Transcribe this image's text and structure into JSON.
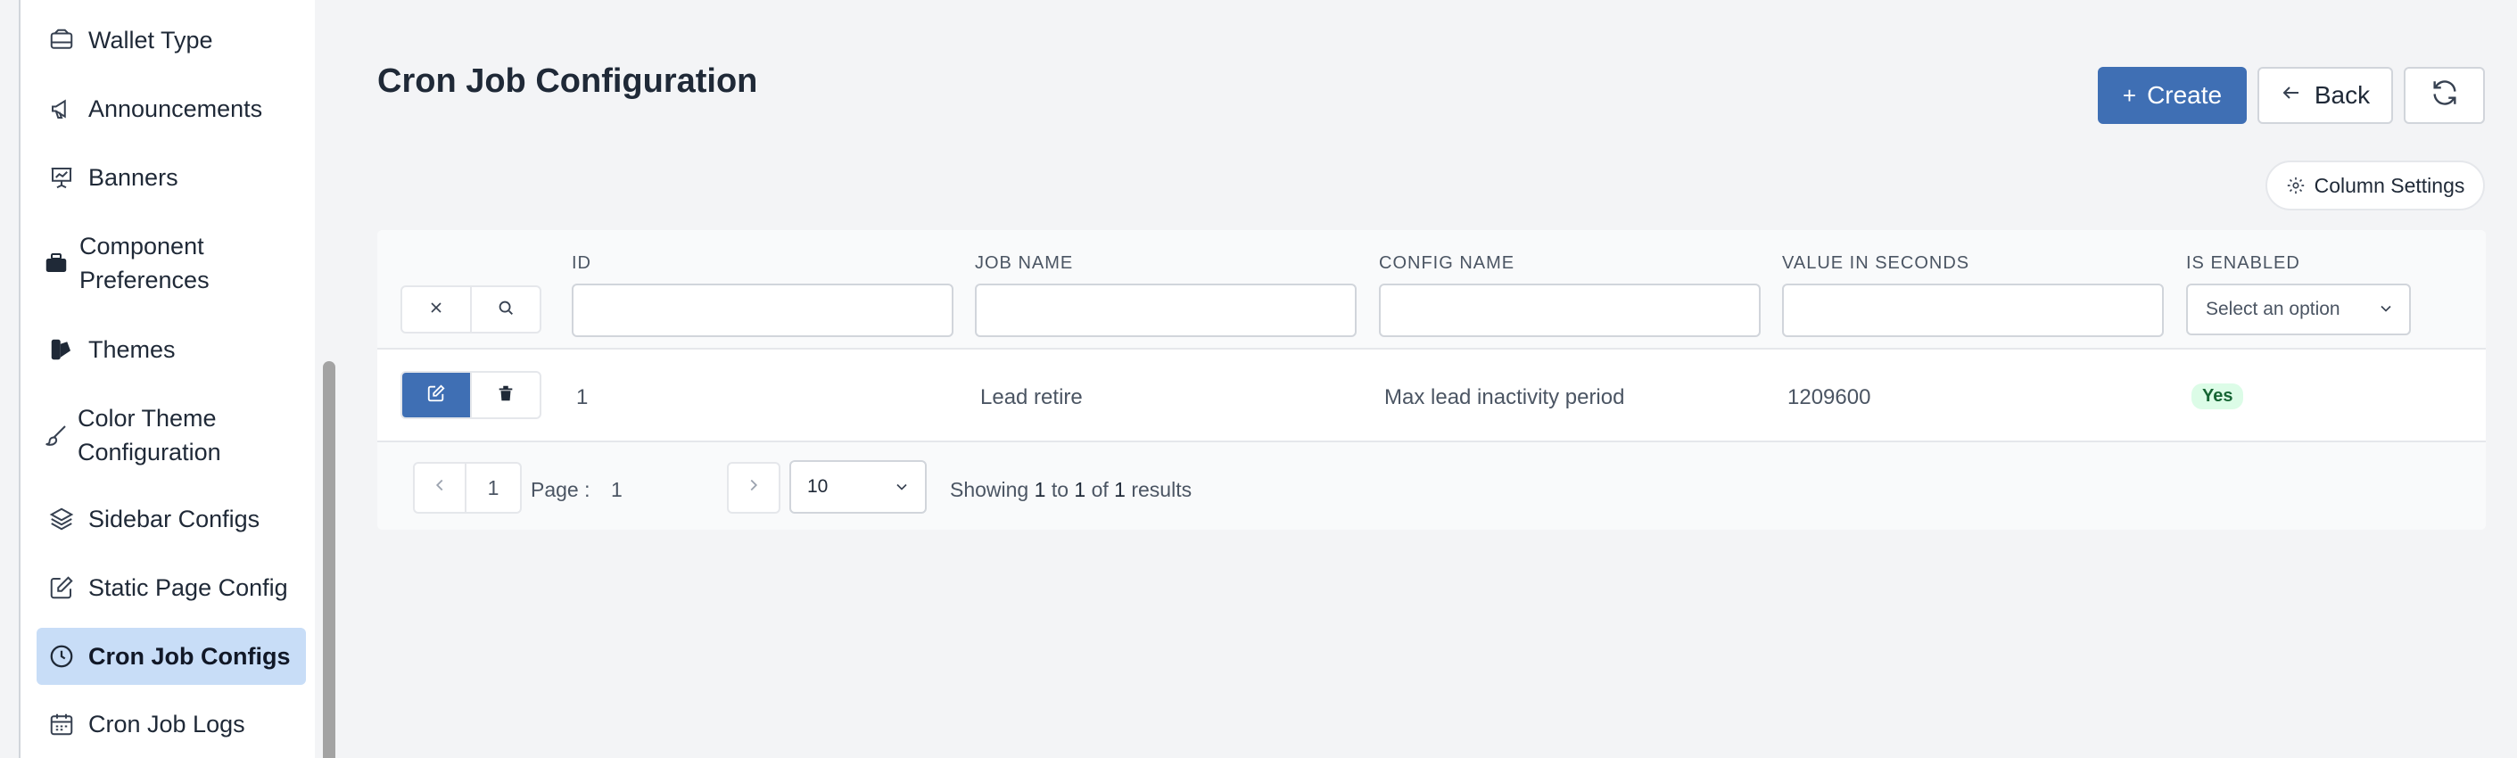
{
  "sidebar": {
    "items": [
      {
        "label": "Wallet Type",
        "icon": "wallet-icon"
      },
      {
        "label": "Announcements",
        "icon": "megaphone-icon"
      },
      {
        "label": "Banners",
        "icon": "presentation-chart-icon"
      },
      {
        "label": "Component Preferences",
        "icon": "briefcase-icon"
      },
      {
        "label": "Themes",
        "icon": "swatch-icon"
      },
      {
        "label": "Color Theme Configuration",
        "icon": "paintbrush-icon"
      },
      {
        "label": "Sidebar Configs",
        "icon": "layers-icon"
      },
      {
        "label": "Static Page Config",
        "icon": "edit-square-icon"
      },
      {
        "label": "Cron Job Configs",
        "icon": "clock-icon",
        "active": true
      },
      {
        "label": "Cron Job Logs",
        "icon": "calendar-icon"
      }
    ]
  },
  "header": {
    "title": "Cron Job Configuration",
    "create_label": "Create",
    "back_label": "Back",
    "column_settings_label": "Column Settings"
  },
  "table": {
    "columns": [
      "ID",
      "JOB NAME",
      "CONFIG NAME",
      "VALUE IN SECONDS",
      "IS ENABLED"
    ],
    "enabled_filter_placeholder": "Select an option",
    "rows": [
      {
        "id": "1",
        "job_name": "Lead retire",
        "config_name": "Max lead inactivity period",
        "value_in_seconds": "1209600",
        "is_enabled": "Yes"
      }
    ]
  },
  "pagination": {
    "current_page": "1",
    "page_label": "Page :",
    "page_value": "1",
    "page_size": "10",
    "summary_prefix": "Showing",
    "from": "1",
    "to_word": "to",
    "to": "1",
    "of_word": "of",
    "total": "1",
    "results_word": "results"
  },
  "colors": {
    "primary": "#3f6fb4",
    "active_bg": "#c8ddf7",
    "enabled_badge_bg": "#dcfce7",
    "enabled_badge_text": "#166534"
  }
}
